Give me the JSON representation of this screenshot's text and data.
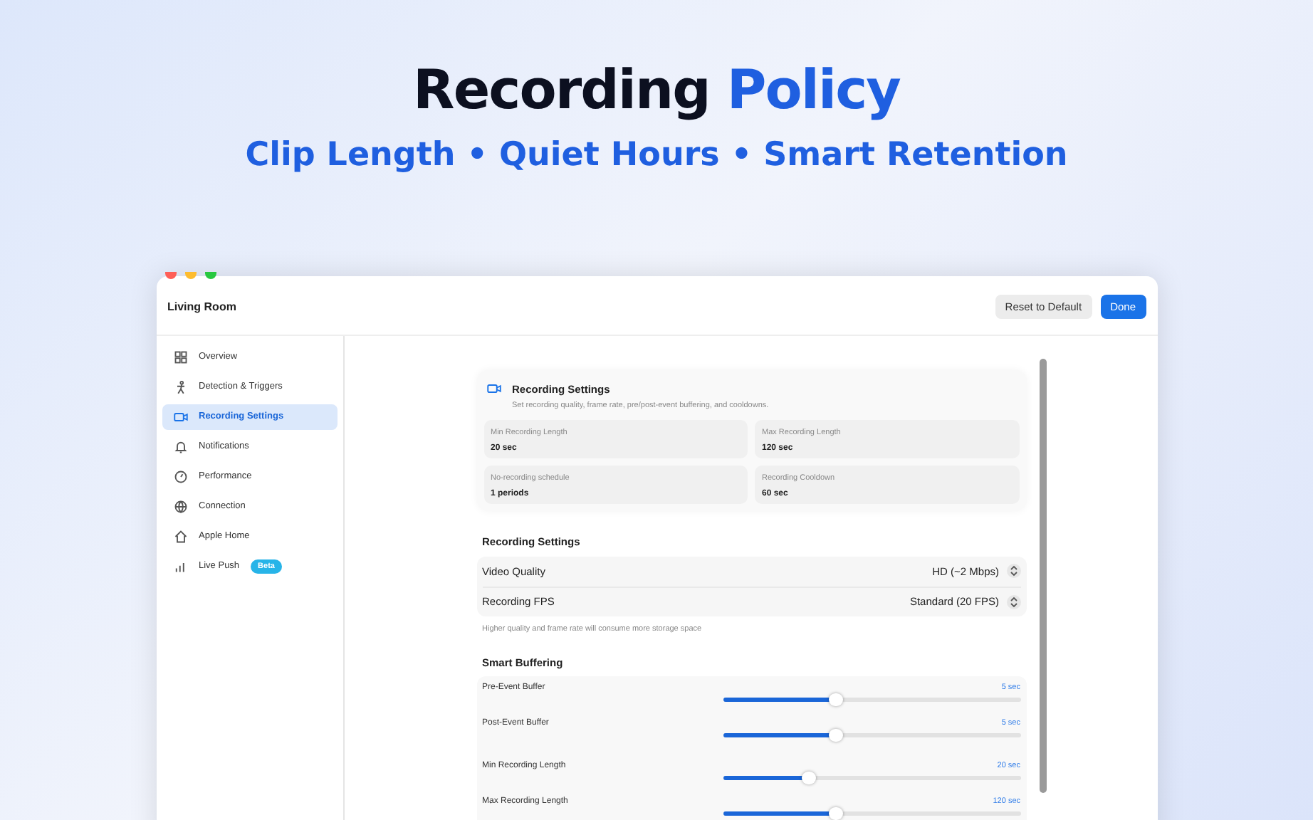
{
  "hero": {
    "title": [
      {
        "text": "Recording",
        "accent": false
      },
      {
        "text": "Policy",
        "accent": true
      }
    ],
    "subtitle": "Clip Length • Quiet Hours • Smart Retention"
  },
  "window": {
    "title": "Living Room",
    "buttons": [
      {
        "label": "Reset to Default",
        "kind": "secondary"
      },
      {
        "label": "Done",
        "kind": "primary"
      }
    ]
  },
  "sidebar": {
    "items": [
      {
        "label": "Overview",
        "kind": "grid",
        "selected": false
      },
      {
        "label": "Detection & Triggers",
        "kind": "person",
        "selected": false
      },
      {
        "label": "Recording Settings",
        "kind": "video",
        "selected": true
      },
      {
        "label": "Notifications",
        "kind": "bell",
        "selected": false
      },
      {
        "label": "Performance",
        "kind": "gauge",
        "selected": false
      },
      {
        "label": "Connection",
        "kind": "globe",
        "selected": false
      },
      {
        "label": "Apple Home",
        "kind": "home",
        "selected": false
      },
      {
        "label": "Live Push",
        "kind": "signal",
        "selected": false,
        "badge": "Beta"
      }
    ]
  },
  "summary": {
    "title": "Recording Settings",
    "description": "Set recording quality, frame rate, pre/post-event buffering, and cooldowns.",
    "stats": [
      {
        "label": "Min Recording Length",
        "value": "20 sec"
      },
      {
        "label": "Max Recording Length",
        "value": "120 sec"
      },
      {
        "label": "No-recording schedule",
        "value": "1 periods"
      },
      {
        "label": "Recording Cooldown",
        "value": "60 sec"
      }
    ]
  },
  "recording_settings": {
    "heading": "Recording Settings",
    "rows": [
      {
        "label": "Video Quality",
        "value": "HD (~2 Mbps)"
      },
      {
        "label": "Recording FPS",
        "value": "Standard (20 FPS)"
      }
    ],
    "note": "Higher quality and frame rate will consume more storage space"
  },
  "smart_buffering": {
    "heading": "Smart Buffering",
    "sliders": [
      {
        "label": "Pre-Event Buffer",
        "reading": "5 sec",
        "level": 0.38
      },
      {
        "label": "Post-Event Buffer",
        "reading": "5 sec",
        "level": 0.38
      },
      {
        "label": "Min Recording Length",
        "reading": "20 sec",
        "level": 0.29
      },
      {
        "label": "Max Recording Length",
        "reading": "120 sec",
        "level": 0.38
      }
    ]
  }
}
